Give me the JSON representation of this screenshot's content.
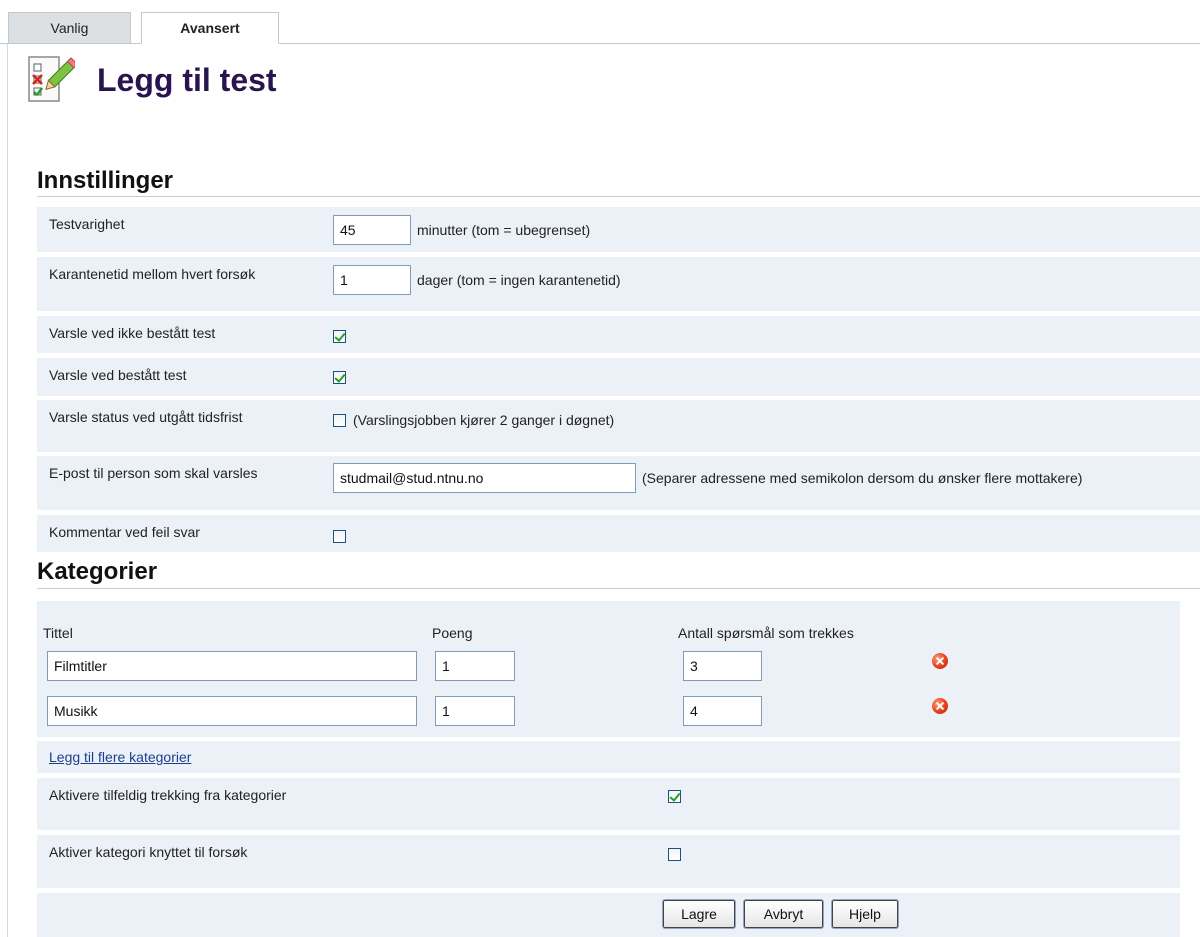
{
  "tabs": [
    {
      "label": "Vanlig",
      "active": false
    },
    {
      "label": "Avansert",
      "active": true
    }
  ],
  "page": {
    "title": "Legg til test",
    "icon": "checklist-edit-icon"
  },
  "settings": {
    "heading": "Innstillinger",
    "rows": {
      "duration": {
        "label": "Testvarighet",
        "value": "45",
        "hint": "minutter (tom = ubegrenset)"
      },
      "quarantine": {
        "label": "Karantenetid mellom hvert forsøk",
        "value": "1",
        "hint": "dager (tom = ingen karantenetid)"
      },
      "notify_fail": {
        "label": "Varsle ved ikke bestått test",
        "checked": true
      },
      "notify_pass": {
        "label": "Varsle ved bestått test",
        "checked": true
      },
      "notify_deadline": {
        "label": "Varsle status ved utgått tidsfrist",
        "checked": false,
        "hint": "(Varslingsjobben kjører 2 ganger i døgnet)"
      },
      "email": {
        "label": "E-post til person som skal varsles",
        "value": "studmail@stud.ntnu.no",
        "hint": "(Separer adressene med semikolon dersom du ønsker flere mottakere)"
      },
      "comment_wrong": {
        "label": "Kommentar ved feil svar",
        "checked": false
      }
    }
  },
  "categories": {
    "heading": "Kategorier",
    "columns": {
      "title": "Tittel",
      "points": "Poeng",
      "count": "Antall spørsmål som trekkes"
    },
    "items": [
      {
        "title": "Filmtitler",
        "points": "1",
        "count": "3"
      },
      {
        "title": "Musikk",
        "points": "1",
        "count": "4"
      }
    ],
    "add_more_link": "Legg til flere kategorier",
    "random_draw": {
      "label": "Aktivere tilfeldig trekking fra kategorier",
      "checked": true
    },
    "category_per_attempt": {
      "label": "Aktiver kategori knyttet til forsøk",
      "checked": false
    }
  },
  "buttons": {
    "save": "Lagre",
    "cancel": "Avbryt",
    "help": "Hjelp"
  },
  "colors": {
    "title": "#2a1450",
    "row_bg": "#ecf1f7",
    "link": "#1a3f8f",
    "check": "#21a121",
    "delete": "#e2401a"
  }
}
